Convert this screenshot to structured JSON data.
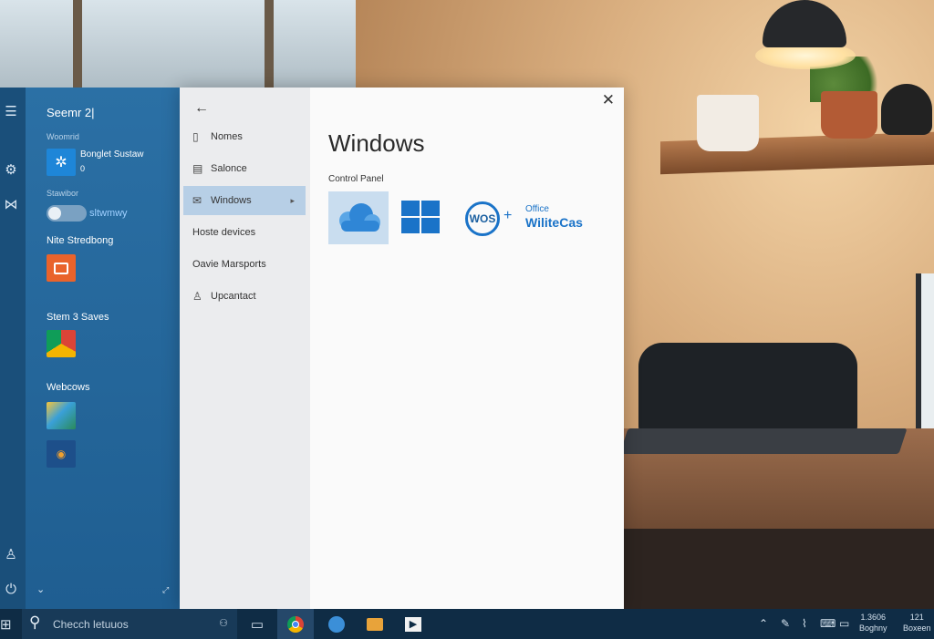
{
  "start_menu": {
    "title": "Seemr 2|",
    "section1_label": "Woomrid",
    "app1_name": "Bonglet Sustaw",
    "app1_sub": "0",
    "section2_label": "Stawibor",
    "toggle_text": "sltwmwy",
    "section3_label": "Nite Stredbong",
    "section4_label": "Stem 3 Saves",
    "section5_label": "Webcows"
  },
  "window": {
    "back_icon": "back-arrow-icon",
    "close_icon": "close-icon",
    "title": "Windows",
    "section_label": "Control Panel",
    "nav_items": [
      {
        "label": "Nomes",
        "icon": "document-icon"
      },
      {
        "label": "Salonce",
        "icon": "layout-icon"
      },
      {
        "label": "Windows",
        "icon": "mail-icon",
        "active": true
      },
      {
        "label": "Hoste devices",
        "icon": ""
      },
      {
        "label": "Oavie Marsports",
        "icon": ""
      },
      {
        "label": "Upcantact",
        "icon": "person-icon"
      }
    ],
    "tile_os_text": "WOS",
    "tile_plus": "+",
    "tile_office_small": "Office",
    "tile_brand": "WiliteCas"
  },
  "taskbar": {
    "search_placeholder": "Checch letuuos",
    "clock_time": "1.3606",
    "clock_date": "Boghny",
    "clock2_top": "121",
    "clock2_bottom": "Boxeen"
  },
  "colors": {
    "accent": "#1a73c8",
    "start_panel": "#2b70a5",
    "taskbar": "#0f2c45",
    "active_nav": "#b7cfe6"
  }
}
